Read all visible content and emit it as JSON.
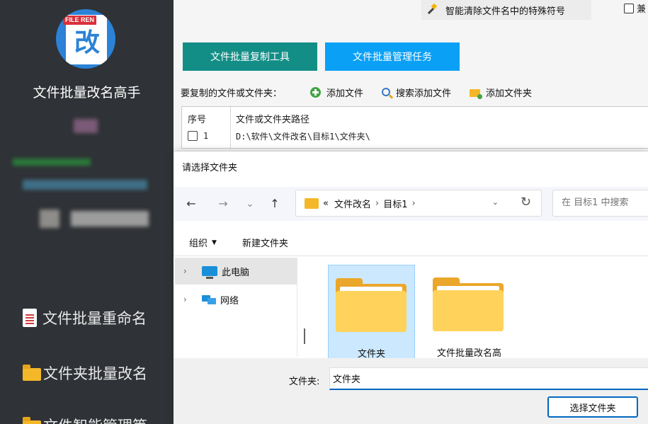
{
  "sidebar": {
    "logo_tag": "FILE REN",
    "logo_glyph": "改",
    "app_title": "文件批量改名高手",
    "nav": [
      {
        "label": "文件批量重命名",
        "icon": "document-icon"
      },
      {
        "label": "文件夹批量改名",
        "icon": "folder-icon"
      },
      {
        "label": "文件智能管理等",
        "icon": "folder-icon"
      }
    ]
  },
  "top": {
    "clean_special_label": "智能清除文件名中的特殊符号",
    "compat_label": "兼"
  },
  "tabs": [
    {
      "label": "文件批量复制工具",
      "color": "#138e87"
    },
    {
      "label": "文件批量管理任务",
      "color": "#0aa0f5"
    }
  ],
  "toolbar": {
    "section_label": "要复制的文件或文件夹：",
    "add_file": "添加文件",
    "search_add_file": "搜索添加文件",
    "add_folder": "添加文件夹"
  },
  "file_table": {
    "headers": [
      "序号",
      "文件或文件夹路径"
    ],
    "rows": [
      {
        "index": "1",
        "path": "D:\\软件\\文件改名\\目标1\\文件夹\\",
        "checked": false
      }
    ]
  },
  "dialog": {
    "title": "请选择文件夹",
    "nav": {
      "back": "←",
      "forward": "→",
      "recent": "⌄",
      "up": "↑"
    },
    "address": {
      "prefix": "«",
      "crumbs": [
        "文件改名",
        "目标1"
      ],
      "separator": "›",
      "dropdown": "⌄",
      "refresh": "↻"
    },
    "search_placeholder": "在 目标1 中搜索",
    "commands": {
      "organize": "组织",
      "organize_arrow": "▼",
      "new_folder": "新建文件夹"
    },
    "tree": [
      {
        "label": "此电脑",
        "icon": "computer-icon",
        "selected": true
      },
      {
        "label": "网络",
        "icon": "network-icon",
        "selected": false
      }
    ],
    "tiles": [
      {
        "name": "文件夹",
        "selected": true
      },
      {
        "name": "文件批量改名高",
        "selected": false
      }
    ],
    "folder_label": "文件夹:",
    "folder_value": "文件夹",
    "select_button": "选择文件夹"
  },
  "colors": {
    "sidebar_bg": "#2f3236",
    "accent_teal": "#138e87",
    "accent_blue": "#0aa0f5",
    "windows_blue": "#0067c0"
  }
}
